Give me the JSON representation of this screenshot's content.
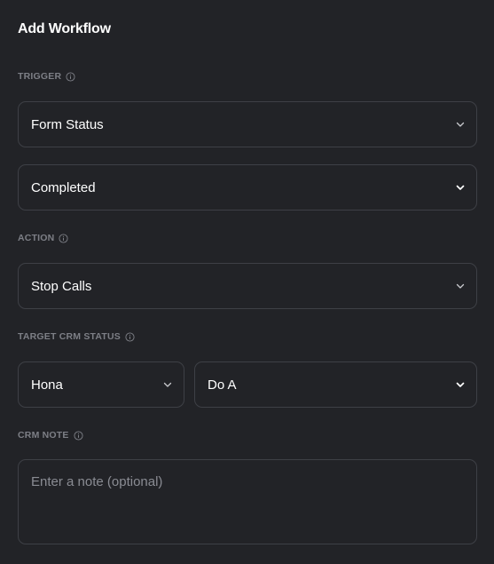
{
  "title": "Add Workflow",
  "sections": {
    "trigger_label": "TRIGGER",
    "action_label": "ACTION",
    "target_label": "TARGET CRM STATUS",
    "note_label": "CRM NOTE"
  },
  "fields": {
    "trigger_type": "Form Status",
    "trigger_value": "Completed",
    "action": "Stop Calls",
    "crm_status": "Hona",
    "crm_substatus": "Do A",
    "note_placeholder": "Enter a note (optional)",
    "note_value": ""
  },
  "icons": {
    "info": "info-icon",
    "dropdown": "chevron-down-icon"
  },
  "colors": {
    "background": "#222327",
    "border": "#3e4046",
    "label": "#7d7f86",
    "text": "#ffffff",
    "placeholder": "#8a8c93"
  }
}
